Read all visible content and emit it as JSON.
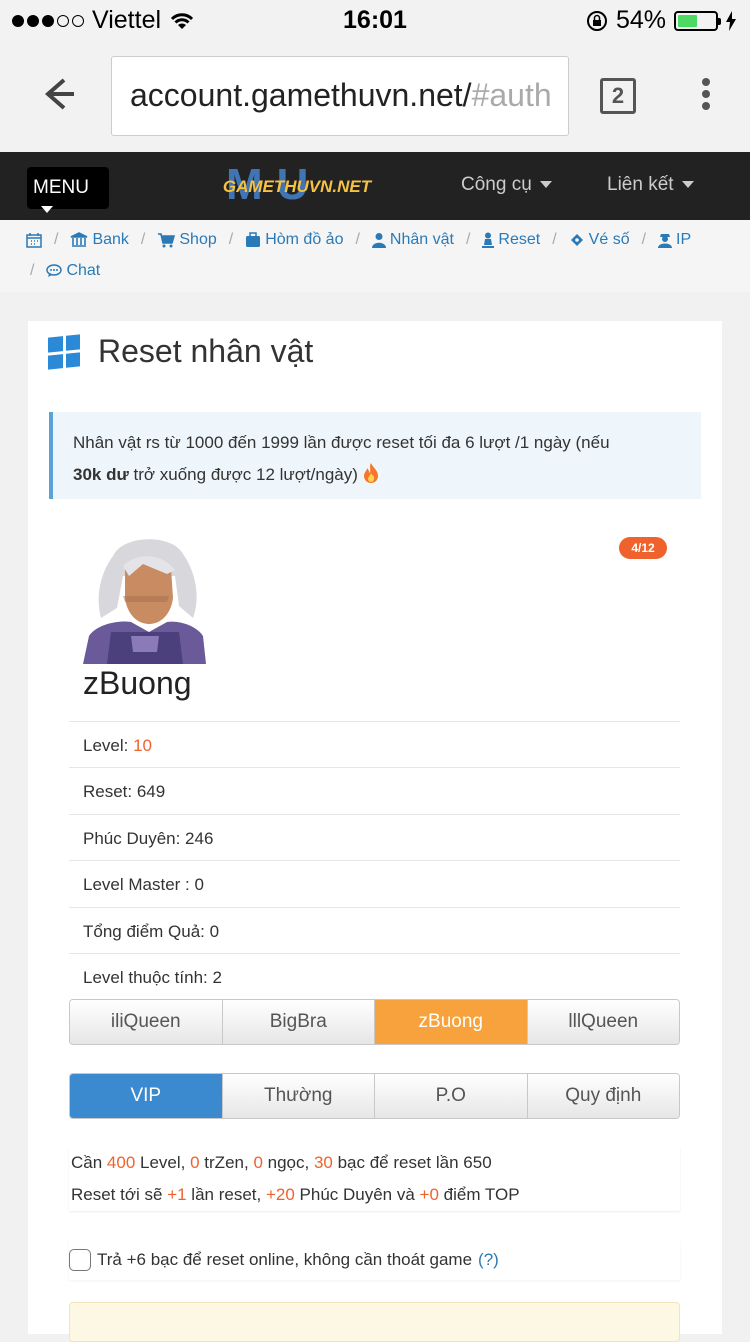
{
  "status": {
    "carrier": "Viettel",
    "time": "16:01",
    "battery": "54%"
  },
  "browser": {
    "url_main": "account.gamethuvn.net/",
    "url_faded": "#auth",
    "tab_count": "2"
  },
  "nav": {
    "menu_label": "MENU",
    "logo_text": "GAMETHUVN.NET",
    "logo_mu": "MU",
    "tools_label": "Công cụ",
    "links_label": "Liên kết"
  },
  "breadcrumb": {
    "items": [
      "Bank",
      "Shop",
      "Hòm đồ ảo",
      "Nhân vật",
      "Reset",
      "Vé số",
      "IP",
      "Chat"
    ]
  },
  "card": {
    "title": "Reset nhân vật",
    "notice_text": "Nhân vật rs từ 1000 đến 1999 lần được reset tối đa 6 lượt /1 ngày (nếu",
    "notice_bold": "30k dư",
    "notice_rest": "trở xuống được 12 lượt/ngày)",
    "badge": "4/12",
    "char_name": "zBuong"
  },
  "stats": {
    "level_label": "Level: ",
    "level_value": "10",
    "reset": "Reset: 649",
    "phuc_duyen": "Phúc Duyên: 246",
    "level_master": "Level Master : 0",
    "tong_diem": "Tổng điểm Quả: 0",
    "level_thuoc_tinh": "Level thuộc tính: 2"
  },
  "characters": [
    "iliQueen",
    "BigBra",
    "zBuong",
    "lllQueen"
  ],
  "modes": [
    "VIP",
    "Thường",
    "P.O",
    "Quy định"
  ],
  "requirement": {
    "line1_a": "Cần ",
    "level": "400",
    "line1_b": " Level, ",
    "trzen": "0",
    "line1_c": " trZen, ",
    "ngoc": "0",
    "line1_d": " ngọc, ",
    "bac": "30",
    "line1_e": " bạc để reset lần 650",
    "line2_a": "Reset tới sẽ ",
    "plus_reset": "+1",
    "line2_b": " lần reset, ",
    "plus_pd": "+20",
    "line2_c": " Phúc Duyên và ",
    "plus_top": "+0",
    "line2_d": " điểm TOP"
  },
  "online": {
    "text": "Trả +6 bạc để reset online, không cần thoát game",
    "help": "(?)"
  },
  "colors": {
    "accent_orange": "#f0622d",
    "selected_char": "#f7a23c",
    "selected_mode": "#3b89cf",
    "link": "#2a7ab8"
  }
}
